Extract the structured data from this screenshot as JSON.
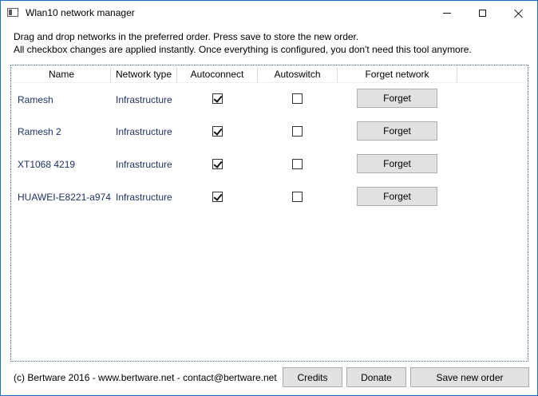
{
  "window": {
    "title": "Wlan10 network manager"
  },
  "instructions": {
    "line1": "Drag and drop networks in the preferred order. Press save to store the new order.",
    "line2": "All checkbox changes are applied instantly. Once everything is configured, you don't need this tool anymore."
  },
  "table": {
    "headers": {
      "name": "Name",
      "network_type": "Network type",
      "autoconnect": "Autoconnect",
      "autoswitch": "Autoswitch",
      "forget": "Forget network"
    },
    "rows": [
      {
        "name": "Ramesh",
        "network_type": "Infrastructure",
        "autoconnect": true,
        "autoswitch": false,
        "forget_label": "Forget"
      },
      {
        "name": "Ramesh 2",
        "network_type": "Infrastructure",
        "autoconnect": true,
        "autoswitch": false,
        "forget_label": "Forget"
      },
      {
        "name": "XT1068 4219",
        "network_type": "Infrastructure",
        "autoconnect": true,
        "autoswitch": false,
        "forget_label": "Forget"
      },
      {
        "name": "HUAWEI-E8221-a974",
        "network_type": "Infrastructure",
        "autoconnect": true,
        "autoswitch": false,
        "forget_label": "Forget"
      }
    ]
  },
  "footer": {
    "credits_text": "(c) Bertware 2016 - www.bertware.net - contact@bertware.net",
    "credits_button": "Credits",
    "donate_button": "Donate",
    "save_button": "Save new order"
  },
  "colors": {
    "window_border": "#1a73c9",
    "row_text": "#1b2f5e",
    "button_bg": "#e1e1e1",
    "button_border": "#adadad"
  }
}
